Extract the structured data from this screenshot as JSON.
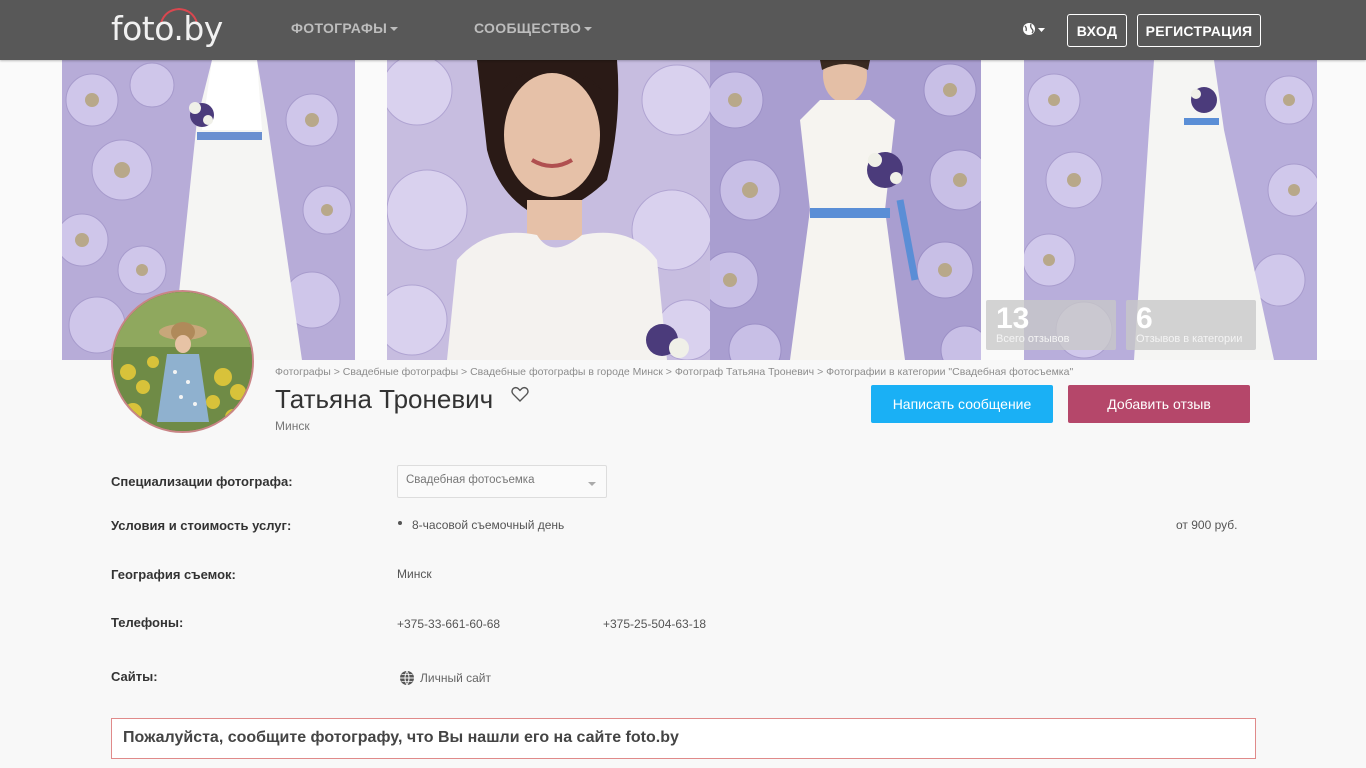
{
  "header": {
    "logo": "foto.by",
    "nav": [
      {
        "label": "ФОТОГРАФЫ"
      },
      {
        "label": "СООБЩЕСТВО"
      }
    ],
    "login": "ВХОД",
    "register": "РЕГИСТРАЦИЯ"
  },
  "stats": {
    "total_reviews": {
      "value": "13",
      "label": "Всего отзывов"
    },
    "category_reviews": {
      "value": "6",
      "label": "Отзывов в категории"
    }
  },
  "breadcrumb": [
    "Фотографы",
    "Свадебные фотографы",
    "Свадебные фотографы в городе Минск",
    "Фотограф Татьяна Троневич",
    "Фотографии в категории \"Свадебная фотосъемка\""
  ],
  "profile": {
    "name": "Татьяна Троневич",
    "city": "Минск",
    "message_button": "Написать сообщение",
    "review_button": "Добавить отзыв"
  },
  "details": {
    "specialization_label": "Специализации фотографа:",
    "specialization_value": "Свадебная фотосъемка",
    "services_label": "Условия и стоимость услуг:",
    "service_name": "8-часовой съемочный день",
    "service_price": "от 900 руб.",
    "geo_label": "География съемок:",
    "geo_value": "Минск",
    "phones_label": "Телефоны:",
    "phones": [
      "+375-33-661-60-68",
      "+375-25-504-63-18"
    ],
    "sites_label": "Сайты:",
    "site_link": "Личный сайт"
  },
  "notice": "Пожалуйста, сообщите фотографу, что Вы нашли его на сайте foto.by"
}
